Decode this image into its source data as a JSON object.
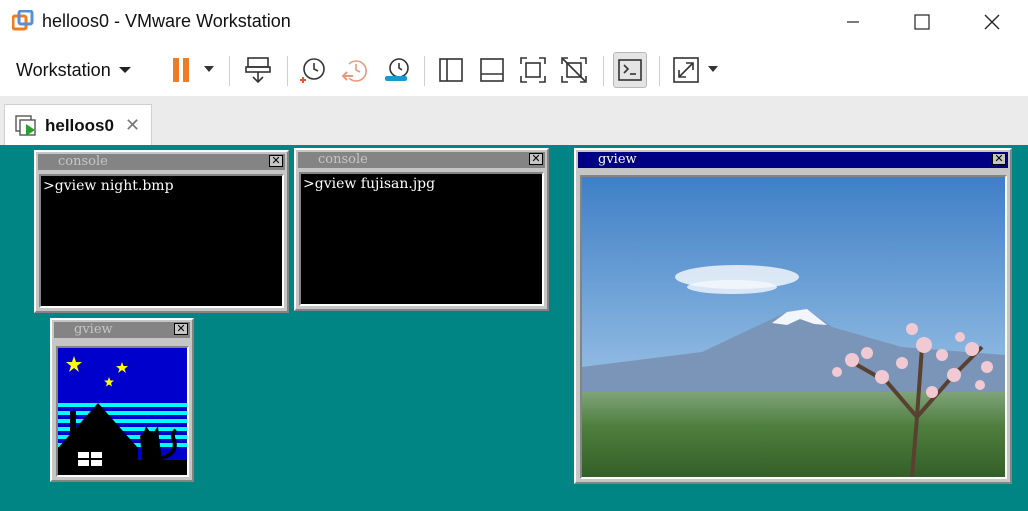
{
  "window": {
    "title": "helloos0 - VMware Workstation",
    "controls": [
      "minimize",
      "maximize",
      "close"
    ]
  },
  "toolbar": {
    "menu_label": "Workstation",
    "icons": [
      "pause-icon",
      "send-ctrl-alt-del-icon",
      "snapshot-take-icon",
      "snapshot-revert-icon",
      "snapshot-manager-icon",
      "library-view-icon",
      "thumbnail-view-icon",
      "full-screen-icon",
      "unity-icon",
      "console-view-icon",
      "stretch-icon"
    ],
    "accent_pause": "#f07c22"
  },
  "tabs": [
    {
      "label": "helloos0",
      "active": true
    }
  ],
  "guest": {
    "desktop_color": "#008484",
    "windows": [
      {
        "title": "console",
        "active": false,
        "lines": [
          ">gview night.bmp"
        ]
      },
      {
        "title": "console",
        "active": false,
        "lines": [
          ">gview fujisan.jpg"
        ]
      },
      {
        "title": "gview",
        "active": true,
        "image": "photo of Mt. Fuji with a flowering tree"
      },
      {
        "title": "gview",
        "active": false,
        "image": "night scene: crescent moon, stars, house and cat"
      }
    ]
  }
}
